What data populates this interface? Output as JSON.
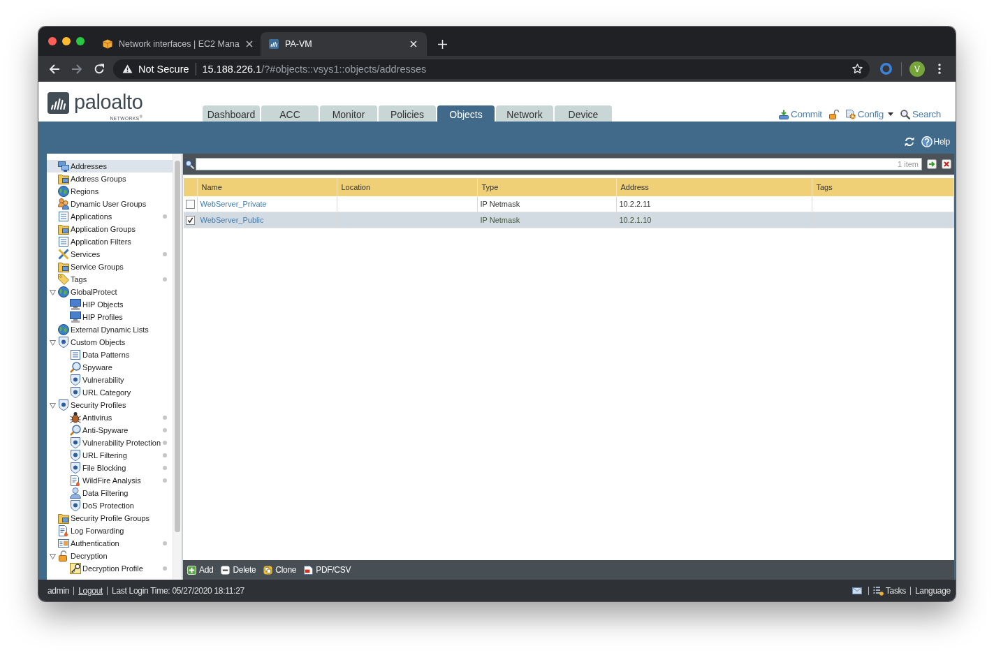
{
  "browser": {
    "tabs": [
      {
        "title": "Network interfaces | EC2 Mana",
        "selected": false
      },
      {
        "title": "PA-VM",
        "selected": true
      }
    ],
    "address_bar": {
      "security_label": "Not Secure",
      "host": "15.188.226.1",
      "path": "/?#objects::vsys1::objects/addresses"
    },
    "profile_initial": "V"
  },
  "app": {
    "logo": {
      "wordmark": "paloalto",
      "tagline": "NETWORKS$^{®}$"
    },
    "nav_tabs": [
      {
        "label": "Dashboard",
        "selected": false
      },
      {
        "label": "ACC",
        "selected": false
      },
      {
        "label": "Monitor",
        "selected": false
      },
      {
        "label": "Policies",
        "selected": false
      },
      {
        "label": "Objects",
        "selected": true
      },
      {
        "label": "Network",
        "selected": false
      },
      {
        "label": "Device",
        "selected": false
      }
    ],
    "header_actions": {
      "commit": "Commit",
      "config": "Config",
      "search": "Search"
    },
    "help": "Help"
  },
  "sidebar": {
    "items": [
      {
        "label": "Addresses",
        "selected": true,
        "dot": false
      },
      {
        "label": "Address Groups",
        "selected": false,
        "dot": false
      },
      {
        "label": "Regions",
        "selected": false,
        "dot": false
      },
      {
        "label": "Dynamic User Groups",
        "selected": false,
        "dot": false
      },
      {
        "label": "Applications",
        "selected": false,
        "dot": true
      },
      {
        "label": "Application Groups",
        "selected": false,
        "dot": false
      },
      {
        "label": "Application Filters",
        "selected": false,
        "dot": false
      },
      {
        "label": "Services",
        "selected": false,
        "dot": true
      },
      {
        "label": "Service Groups",
        "selected": false,
        "dot": false
      },
      {
        "label": "Tags",
        "selected": false,
        "dot": true
      },
      {
        "label": "GlobalProtect",
        "selected": false,
        "dot": false,
        "expanded": true,
        "children": [
          {
            "label": "HIP Objects",
            "selected": false,
            "dot": false
          },
          {
            "label": "HIP Profiles",
            "selected": false,
            "dot": false
          }
        ]
      },
      {
        "label": "External Dynamic Lists",
        "selected": false,
        "dot": false
      },
      {
        "label": "Custom Objects",
        "selected": false,
        "dot": false,
        "expanded": true,
        "children": [
          {
            "label": "Data Patterns",
            "selected": false,
            "dot": false
          },
          {
            "label": "Spyware",
            "selected": false,
            "dot": false
          },
          {
            "label": "Vulnerability",
            "selected": false,
            "dot": false
          },
          {
            "label": "URL Category",
            "selected": false,
            "dot": false
          }
        ]
      },
      {
        "label": "Security Profiles",
        "selected": false,
        "dot": false,
        "expanded": true,
        "children": [
          {
            "label": "Antivirus",
            "selected": false,
            "dot": true
          },
          {
            "label": "Anti-Spyware",
            "selected": false,
            "dot": true
          },
          {
            "label": "Vulnerability Protection",
            "selected": false,
            "dot": true
          },
          {
            "label": "URL Filtering",
            "selected": false,
            "dot": true
          },
          {
            "label": "File Blocking",
            "selected": false,
            "dot": true
          },
          {
            "label": "WildFire Analysis",
            "selected": false,
            "dot": true
          },
          {
            "label": "Data Filtering",
            "selected": false,
            "dot": false
          },
          {
            "label": "DoS Protection",
            "selected": false,
            "dot": false
          }
        ]
      },
      {
        "label": "Security Profile Groups",
        "selected": false,
        "dot": false
      },
      {
        "label": "Log Forwarding",
        "selected": false,
        "dot": false
      },
      {
        "label": "Authentication",
        "selected": false,
        "dot": true
      },
      {
        "label": "Decryption",
        "selected": false,
        "dot": false,
        "expanded": true,
        "children": [
          {
            "label": "Decryption Profile",
            "selected": false,
            "dot": true
          }
        ]
      }
    ]
  },
  "search": {
    "count": "1 item"
  },
  "table": {
    "columns": [
      "Name",
      "Location",
      "Type",
      "Address",
      "Tags"
    ],
    "rows": [
      {
        "name": "WebServer_Private",
        "type": "IP Netmask",
        "address": "10.2.2.11",
        "checked": false,
        "selected": false
      },
      {
        "name": "WebServer_Public",
        "type": "IP Netmask",
        "address": "10.2.1.10",
        "checked": true,
        "selected": true
      }
    ]
  },
  "actions": [
    {
      "kind": "add",
      "label": "Add"
    },
    {
      "kind": "delete",
      "label": "Delete"
    },
    {
      "kind": "clone",
      "label": "Clone"
    },
    {
      "kind": "export",
      "label": "PDF/CSV"
    }
  ],
  "status_bar": {
    "user": "admin",
    "logout": "Logout",
    "last_login": "Last Login Time: 05/27/2020 18:11:27",
    "tasks": "Tasks",
    "language": "Language"
  }
}
